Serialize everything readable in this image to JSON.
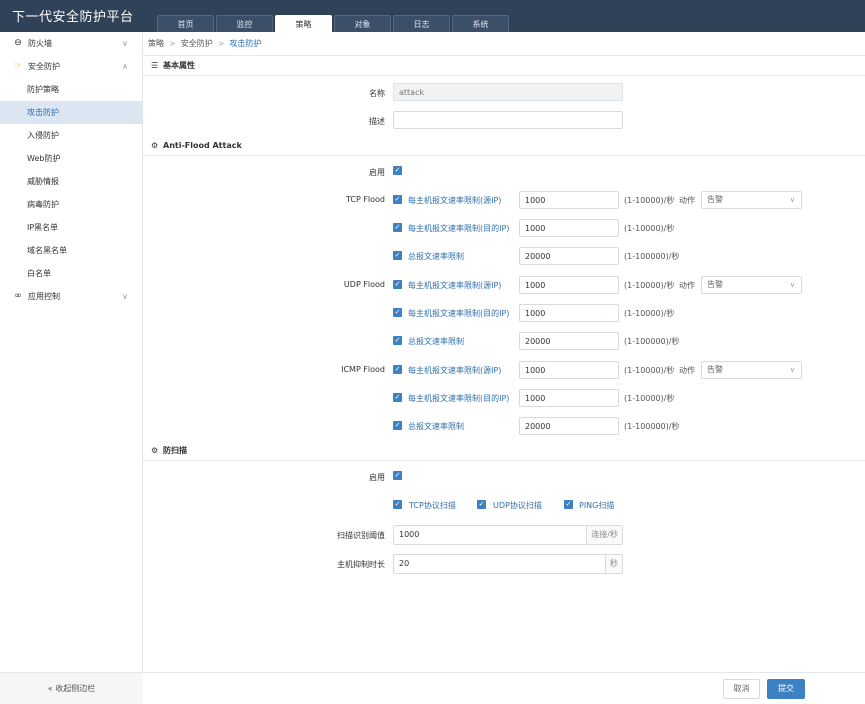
{
  "app": {
    "title": "下一代安全防护平台"
  },
  "tabs": [
    "首页",
    "监控",
    "策略",
    "对象",
    "日志",
    "系统"
  ],
  "sidebar": {
    "groups": [
      {
        "label": "防火墙",
        "expanded": false,
        "icon": "minus-circle-icon"
      },
      {
        "label": "安全防护",
        "expanded": true,
        "icon": "hand-pointer-icon"
      },
      {
        "label": "应用控制",
        "expanded": false,
        "icon": "glasses-icon"
      }
    ],
    "items": [
      "防护策略",
      "攻击防护",
      "入侵防护",
      "Web防护",
      "威胁情报",
      "病毒防护",
      "IP黑名单",
      "域名黑名单",
      "白名单"
    ],
    "collapse_label": "收起侧边栏"
  },
  "breadcrumb": [
    "策略",
    "安全防护",
    "攻击防护"
  ],
  "basic": {
    "title": "基本属性",
    "name_label": "名称",
    "name_placeholder": "attack",
    "desc_label": "描述",
    "desc_value": ""
  },
  "antiflood": {
    "title": "Anti-Flood Attack",
    "enable_label": "启用",
    "action_label": "动作",
    "action_value": "告警",
    "rows": [
      {
        "group": "TCP Flood",
        "label": "每主机报文速率限制(源IP)",
        "value": "1000",
        "range": "(1-10000)/秒"
      },
      {
        "group": "",
        "label": "每主机报文速率限制(目的IP)",
        "value": "1000",
        "range": "(1-10000)/秒"
      },
      {
        "group": "",
        "label": "总报文速率限制",
        "value": "20000",
        "range": "(1-100000)/秒"
      },
      {
        "group": "UDP Flood",
        "label": "每主机报文速率限制(源IP)",
        "value": "1000",
        "range": "(1-10000)/秒"
      },
      {
        "group": "",
        "label": "每主机报文速率限制(目的IP)",
        "value": "1000",
        "range": "(1-10000)/秒"
      },
      {
        "group": "",
        "label": "总报文速率限制",
        "value": "20000",
        "range": "(1-100000)/秒"
      },
      {
        "group": "ICMP Flood",
        "label": "每主机报文速率限制(源IP)",
        "value": "1000",
        "range": "(1-10000)/秒"
      },
      {
        "group": "",
        "label": "每主机报文速率限制(目的IP)",
        "value": "1000",
        "range": "(1-10000)/秒"
      },
      {
        "group": "",
        "label": "总报文速率限制",
        "value": "20000",
        "range": "(1-100000)/秒"
      }
    ]
  },
  "scan": {
    "title": "防扫描",
    "enable_label": "启用",
    "types": [
      "TCP协议扫描",
      "UDP协议扫描",
      "PING扫描"
    ],
    "threshold_label": "扫描识别阈值",
    "threshold_value": "1000",
    "threshold_unit": "连接/秒",
    "block_label": "主机抑制时长",
    "block_value": "20",
    "block_unit": "秒"
  },
  "footer": {
    "cancel_label": "取消",
    "submit_label": "提交"
  },
  "colors": {
    "header": "#2f4258",
    "accent": "#3e81c2",
    "active_nav": "#dbe6f2"
  }
}
